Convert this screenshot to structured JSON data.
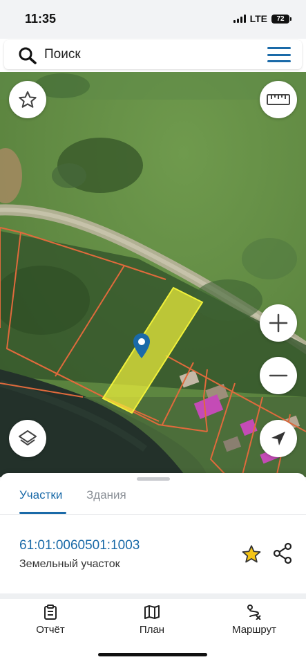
{
  "status_bar": {
    "time": "11:35",
    "network": "LTE",
    "battery": "72"
  },
  "search": {
    "placeholder": "Поиск"
  },
  "map": {
    "icons": {
      "favorite": "star-outline-icon",
      "ruler": "ruler-icon",
      "zoom_in": "plus-icon",
      "zoom_out": "minus-icon",
      "layers": "layers-icon",
      "locate": "navigation-arrow-icon",
      "pin": "map-pin-icon"
    },
    "colors": {
      "parcel_highlight": "#f2f23a",
      "parcel_border": "#e06a3c",
      "pin": "#1a6aa8"
    }
  },
  "sheet": {
    "tabs": [
      {
        "label": "Участки",
        "active": true
      },
      {
        "label": "Здания",
        "active": false
      }
    ],
    "parcel": {
      "cadastral_number": "61:01:0060501:1003",
      "type": "Земельный участок"
    },
    "actions": [
      {
        "label": "Отчёт",
        "icon": "report-icon"
      },
      {
        "label": "План",
        "icon": "map-icon"
      },
      {
        "label": "Маршрут",
        "icon": "route-icon"
      }
    ]
  },
  "colors": {
    "accent": "#1a6aa8",
    "favorite_star": "#f5c518"
  }
}
